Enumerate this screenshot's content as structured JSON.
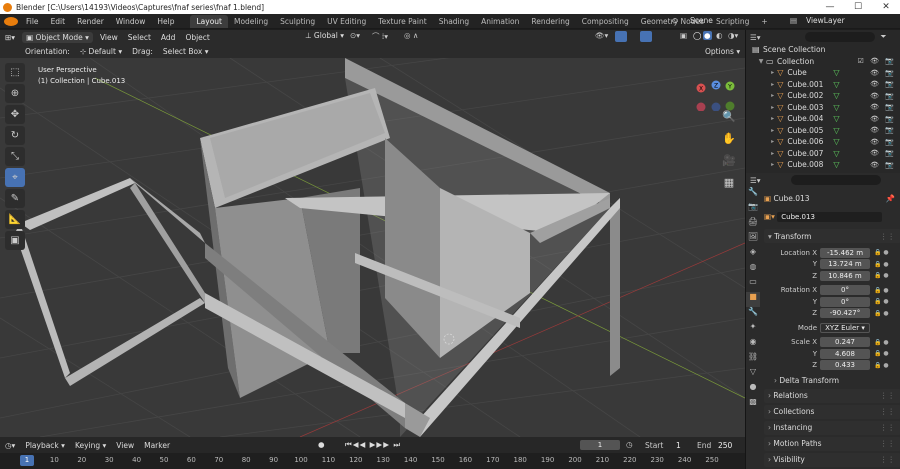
{
  "window": {
    "title": "Blender [C:\\Users\\14193\\Videos\\Captures\\fnaf series\\fnaf 1.blend]",
    "minimize": "—",
    "maximize": "☐",
    "close": "✕"
  },
  "menu": [
    "File",
    "Edit",
    "Render",
    "Window",
    "Help"
  ],
  "workspaces": [
    "Layout",
    "Modeling",
    "Sculpting",
    "UV Editing",
    "Texture Paint",
    "Shading",
    "Animation",
    "Rendering",
    "Compositing",
    "Geometry Nodes",
    "Scripting"
  ],
  "active_workspace": "Layout",
  "scene": "Scene",
  "view_layer": "ViewLayer",
  "header": {
    "mode": "Object Mode",
    "view": "View",
    "select": "Select",
    "add": "Add",
    "object": "Object",
    "transform_orientation": "Global"
  },
  "header2": {
    "orientation_label": "Orientation:",
    "orientation": "Default",
    "drag_label": "Drag:",
    "drag": "Select Box",
    "options": "Options"
  },
  "viewport": {
    "perspective": "User Perspective",
    "collection": "(1) Collection | Cube.013"
  },
  "gizmo": {
    "x": "X",
    "y": "Y",
    "z": "Z"
  },
  "outliner": {
    "root": "Scene Collection",
    "collection": "Collection",
    "items": [
      "Cube",
      "Cube.001",
      "Cube.002",
      "Cube.003",
      "Cube.004",
      "Cube.005",
      "Cube.006",
      "Cube.007",
      "Cube.008"
    ]
  },
  "properties": {
    "object_name": "Cube.013",
    "object_data_name": "Cube.013",
    "transform_label": "Transform",
    "location": {
      "label": "Location X",
      "x": "-15.462 m",
      "y": "13.724 m",
      "z": "10.846 m"
    },
    "rotation": {
      "label": "Rotation X",
      "x": "0°",
      "y": "0°",
      "z": "-90.427°"
    },
    "mode_label": "Mode",
    "mode": "XYZ Euler",
    "scale": {
      "label": "Scale X",
      "x": "0.247",
      "y": "4.608",
      "z": "0.433"
    },
    "axis_y": "Y",
    "axis_z": "Z",
    "delta": "Delta Transform",
    "panels": [
      "Relations",
      "Collections",
      "Instancing",
      "Motion Paths",
      "Visibility"
    ]
  },
  "timeline": {
    "playback": "Playback",
    "keying": "Keying",
    "view": "View",
    "marker": "Marker",
    "frame": "1",
    "start_label": "Start",
    "start": "1",
    "end_label": "End",
    "end": "250"
  },
  "ruler": [
    "1",
    "10",
    "20",
    "30",
    "40",
    "50",
    "60",
    "70",
    "80",
    "90",
    "100",
    "110",
    "120",
    "130",
    "140",
    "150",
    "160",
    "170",
    "180",
    "190",
    "200",
    "210",
    "220",
    "230",
    "240",
    "250"
  ],
  "colors": {
    "accent": "#4772b3",
    "object_orange": "#e87d0d",
    "mesh_green": "#5fcf5f"
  }
}
